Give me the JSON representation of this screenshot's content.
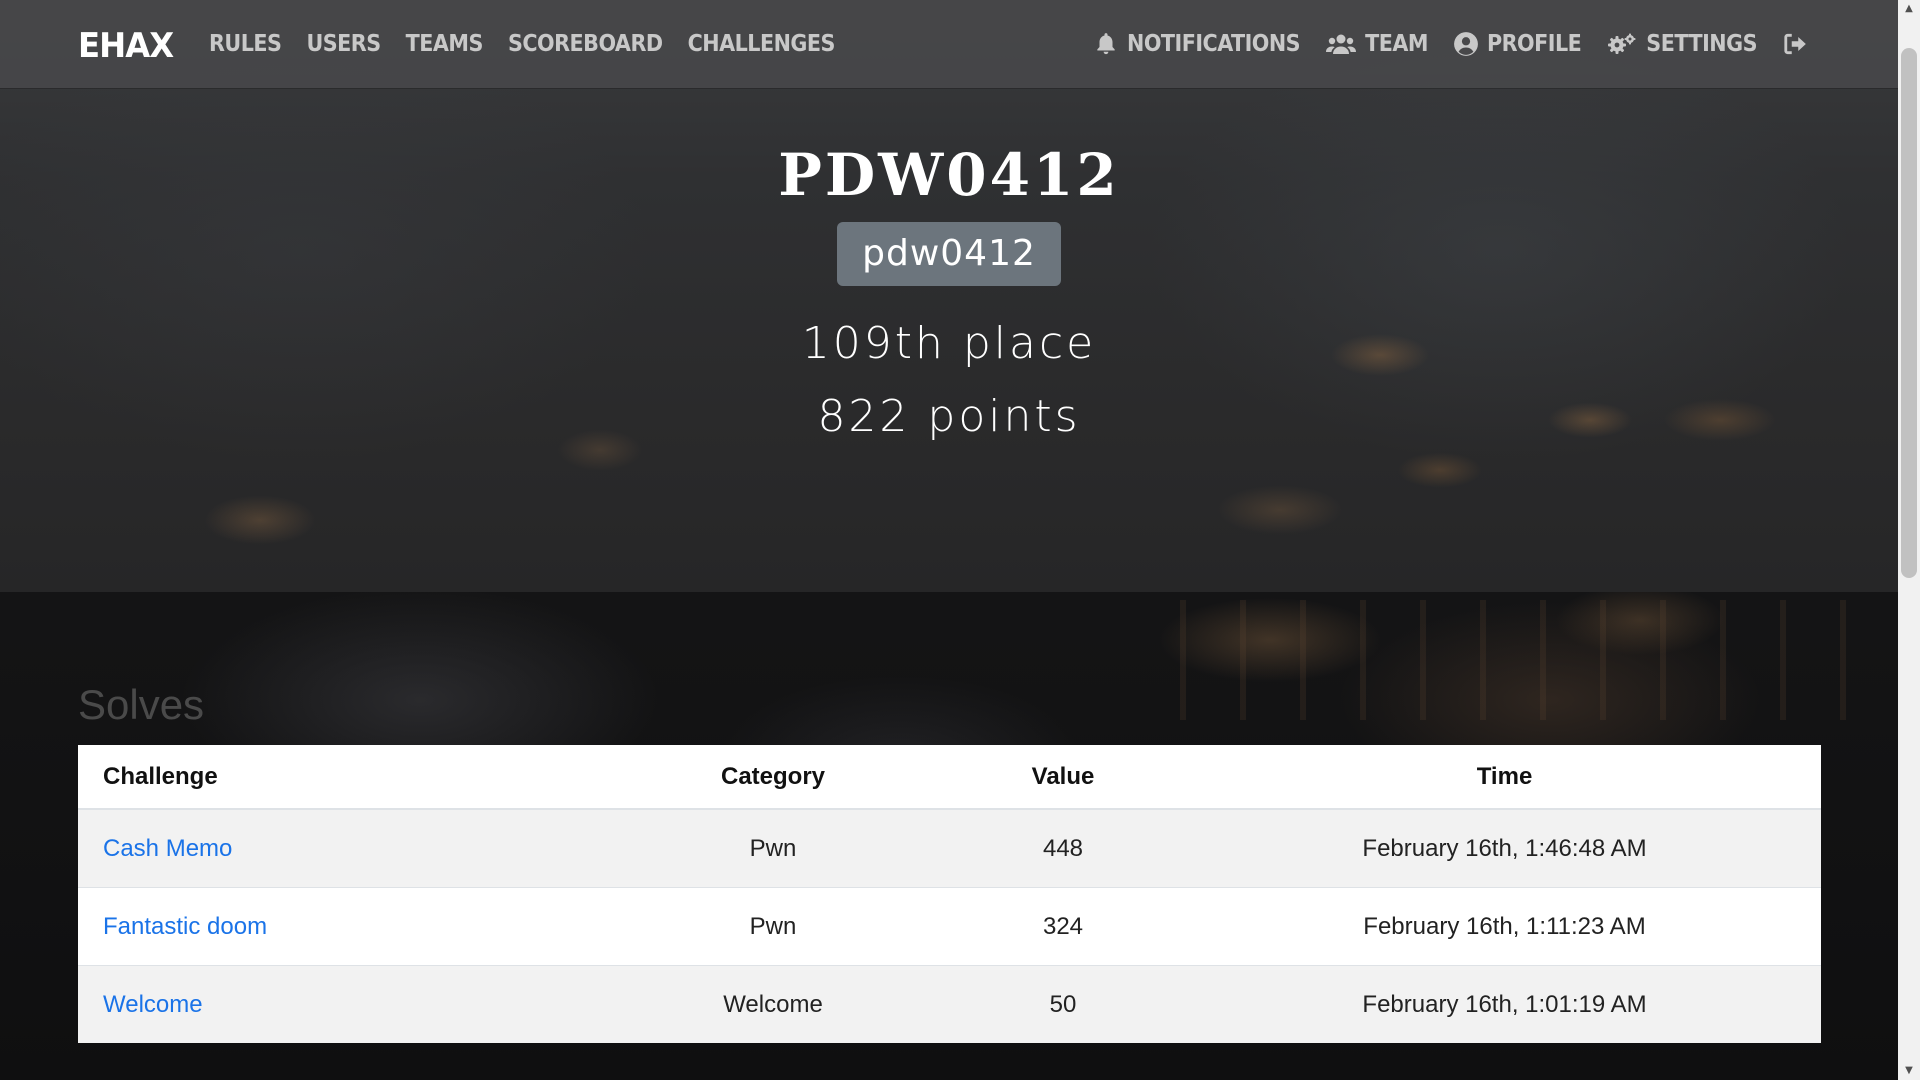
{
  "nav": {
    "logo": "EHAX",
    "left_links": [
      {
        "label": "RULES"
      },
      {
        "label": "USERS"
      },
      {
        "label": "TEAMS"
      },
      {
        "label": "SCOREBOARD"
      },
      {
        "label": "CHALLENGES"
      }
    ],
    "right_links": [
      {
        "label": "NOTIFICATIONS",
        "icon": "bell-icon"
      },
      {
        "label": "TEAM",
        "icon": "users-icon"
      },
      {
        "label": "PROFILE",
        "icon": "user-circle-icon"
      },
      {
        "label": "SETTINGS",
        "icon": "cogs-icon"
      }
    ],
    "logout_icon": "sign-out-icon"
  },
  "profile": {
    "name": "PDW0412",
    "badge": "pdw0412",
    "place": "109th place",
    "points": "822 points"
  },
  "solves": {
    "title": "Solves",
    "columns": [
      "Challenge",
      "Category",
      "Value",
      "Time"
    ],
    "rows": [
      {
        "challenge": "Cash Memo",
        "category": "Pwn",
        "value": "448",
        "time": "February 16th, 1:46:48 AM"
      },
      {
        "challenge": "Fantastic doom",
        "category": "Pwn",
        "value": "324",
        "time": "February 16th, 1:11:23 AM"
      },
      {
        "challenge": "Welcome",
        "category": "Welcome",
        "value": "50",
        "time": "February 16th, 1:01:19 AM"
      }
    ]
  },
  "colors": {
    "navbar": "#48484a",
    "badge": "#6c757d",
    "link": "#1a73e8"
  }
}
